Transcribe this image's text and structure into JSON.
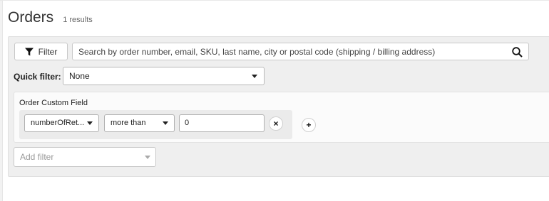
{
  "header": {
    "title": "Orders",
    "results_count": "1 results"
  },
  "filter_bar": {
    "filter_button_label": "Filter",
    "search_placeholder": "Search by order number, email, SKU, last name, city or postal code (shipping / billing address)",
    "search_value": ""
  },
  "quick_filter": {
    "label": "Quick filter:",
    "selected": "None"
  },
  "custom_field_filter": {
    "title": "Order Custom Field",
    "field": "numberOfRet...",
    "operator": "more than",
    "value": "0",
    "remove_symbol": "×",
    "add_symbol": "+"
  },
  "add_filter": {
    "placeholder": "Add filter"
  },
  "icons": {
    "filter": "funnel-icon",
    "search": "search-icon",
    "dropdown": "chevron-down-icon"
  }
}
